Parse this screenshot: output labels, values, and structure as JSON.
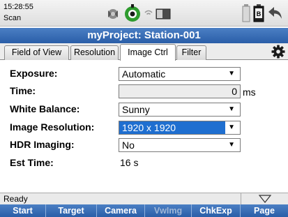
{
  "statusbar": {
    "time": "15:28:55",
    "mode": "Scan",
    "icons": [
      "satellite-icon",
      "instrument-icon",
      "wifi-icon",
      "storage-icon",
      "battery-a-icon",
      "battery-b-icon",
      "back-icon"
    ],
    "battery_b_label": "B"
  },
  "title": "myProject: Station-001",
  "tabs": [
    {
      "label": "Field of View",
      "active": false
    },
    {
      "label": "Resolution",
      "active": false
    },
    {
      "label": "Image Ctrl",
      "active": true
    },
    {
      "label": "Filter",
      "active": false
    }
  ],
  "form": {
    "exposure": {
      "label": "Exposure:",
      "value": "Automatic"
    },
    "time": {
      "label": "Time:",
      "value": "0",
      "unit": "ms"
    },
    "white_balance": {
      "label": "White Balance:",
      "value": "Sunny"
    },
    "image_resolution": {
      "label": "Image Resolution:",
      "value": "1920 x 1920"
    },
    "hdr": {
      "label": "HDR Imaging:",
      "value": "No"
    },
    "est_time": {
      "label": "Est Time:",
      "value": "16 s"
    }
  },
  "status_text": "Ready",
  "softkeys": [
    {
      "label": "Start",
      "enabled": true
    },
    {
      "label": "Target",
      "enabled": true
    },
    {
      "label": "Camera",
      "enabled": true
    },
    {
      "label": "VwImg",
      "enabled": false
    },
    {
      "label": "ChkExp",
      "enabled": true
    },
    {
      "label": "Page",
      "enabled": true
    }
  ],
  "colors": {
    "accent": "#2a5ea8",
    "selection": "#1f6fd0",
    "instrument": "#2e9b2e"
  }
}
